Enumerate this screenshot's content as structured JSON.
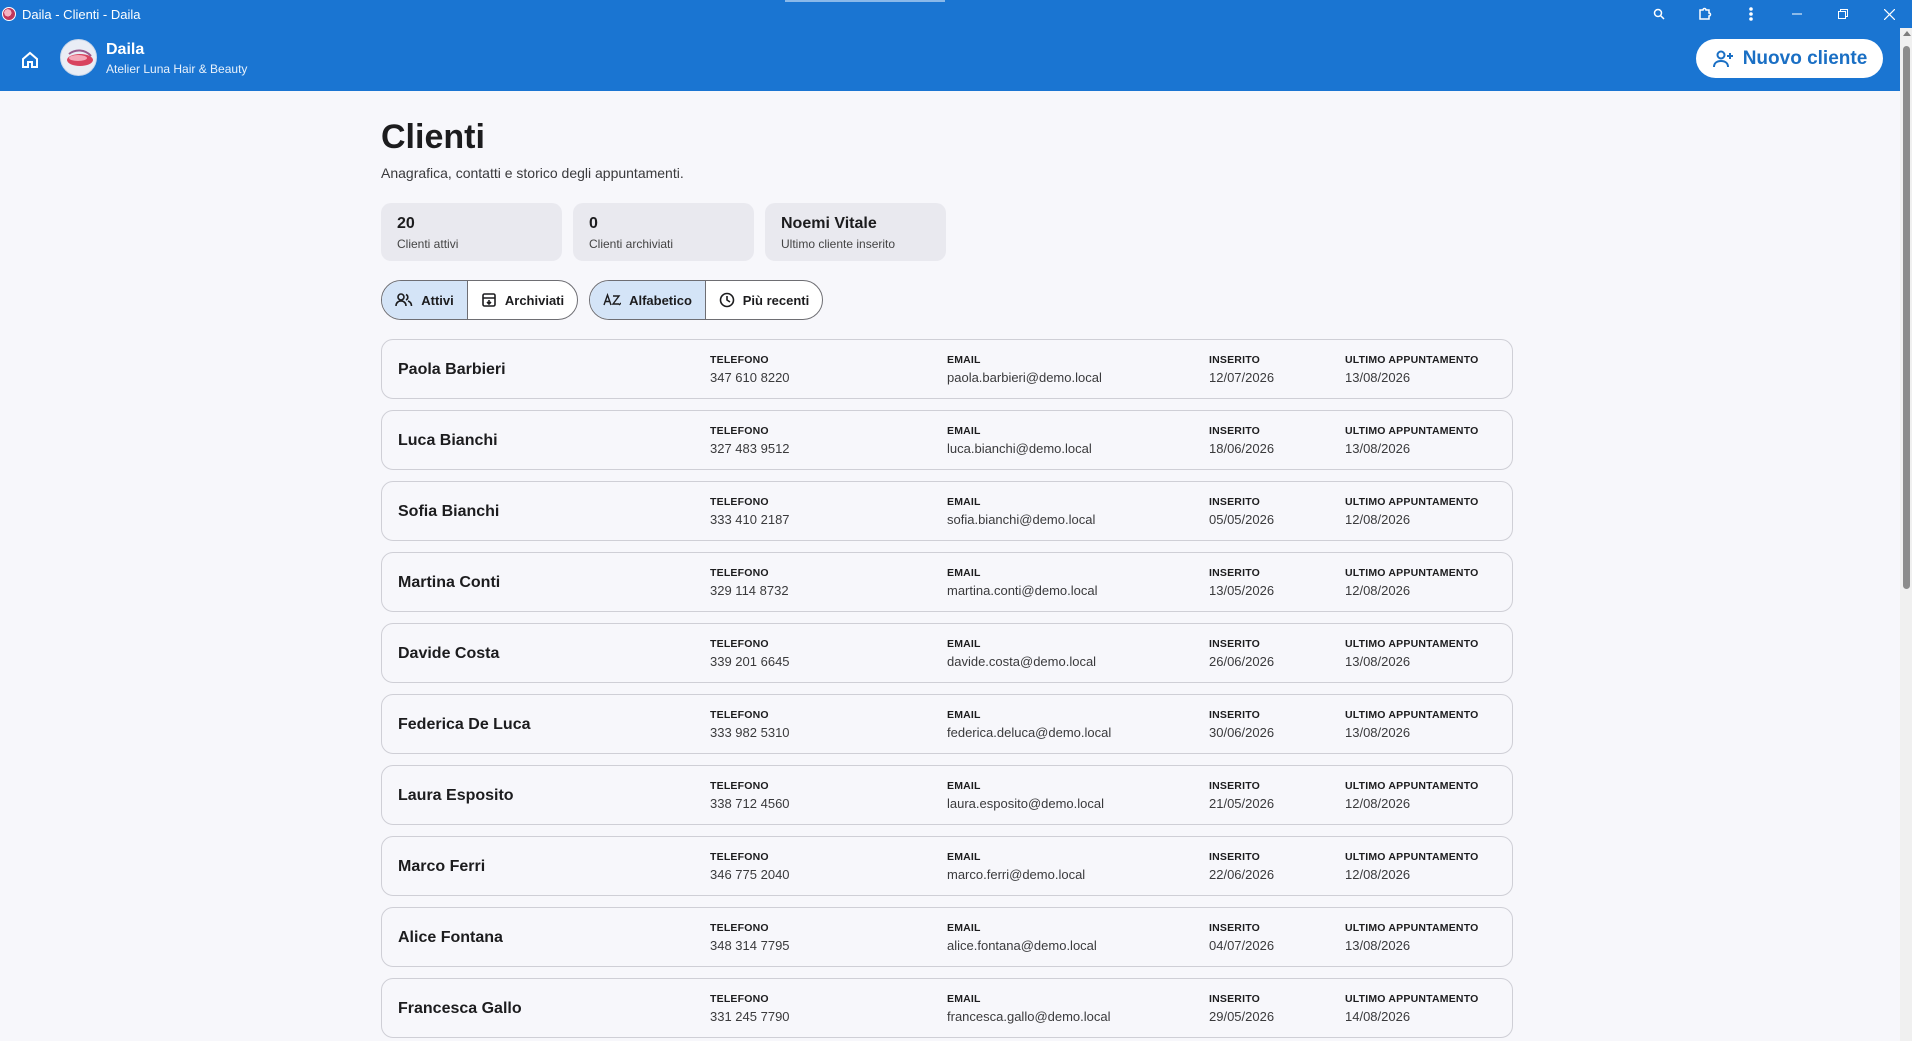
{
  "window": {
    "title": "Daila - Clienti - Daila"
  },
  "header": {
    "brand_name": "Daila",
    "brand_subtitle": "Atelier Luna Hair & Beauty",
    "new_client_label": "Nuovo cliente"
  },
  "page": {
    "title": "Clienti",
    "subtitle": "Anagrafica, contatti e storico degli appuntamenti."
  },
  "stats": [
    {
      "value": "20",
      "label": "Clienti attivi"
    },
    {
      "value": "0",
      "label": "Clienti archiviati"
    },
    {
      "value": "Noemi Vitale",
      "label": "Ultimo cliente inserito"
    }
  ],
  "filters": {
    "status": {
      "active": "Attivi",
      "archived": "Archiviati",
      "selected": "Attivi"
    },
    "sort": {
      "alpha": "Alfabetico",
      "recent": "Più recenti",
      "selected": "Alfabetico"
    }
  },
  "columns": {
    "phone": "TELEFONO",
    "email": "EMAIL",
    "inserted": "INSERITO",
    "last_appointment": "ULTIMO APPUNTAMENTO"
  },
  "clients": [
    {
      "name": "Paola Barbieri",
      "phone": "347 610 8220",
      "email": "paola.barbieri@demo.local",
      "inserted": "12/07/2026",
      "last": "13/08/2026"
    },
    {
      "name": "Luca Bianchi",
      "phone": "327 483 9512",
      "email": "luca.bianchi@demo.local",
      "inserted": "18/06/2026",
      "last": "13/08/2026"
    },
    {
      "name": "Sofia Bianchi",
      "phone": "333 410 2187",
      "email": "sofia.bianchi@demo.local",
      "inserted": "05/05/2026",
      "last": "12/08/2026"
    },
    {
      "name": "Martina Conti",
      "phone": "329 114 8732",
      "email": "martina.conti@demo.local",
      "inserted": "13/05/2026",
      "last": "12/08/2026"
    },
    {
      "name": "Davide Costa",
      "phone": "339 201 6645",
      "email": "davide.costa@demo.local",
      "inserted": "26/06/2026",
      "last": "13/08/2026"
    },
    {
      "name": "Federica De Luca",
      "phone": "333 982 5310",
      "email": "federica.deluca@demo.local",
      "inserted": "30/06/2026",
      "last": "13/08/2026"
    },
    {
      "name": "Laura Esposito",
      "phone": "338 712 4560",
      "email": "laura.esposito@demo.local",
      "inserted": "21/05/2026",
      "last": "12/08/2026"
    },
    {
      "name": "Marco Ferri",
      "phone": "346 775 2040",
      "email": "marco.ferri@demo.local",
      "inserted": "22/06/2026",
      "last": "12/08/2026"
    },
    {
      "name": "Alice Fontana",
      "phone": "348 314 7795",
      "email": "alice.fontana@demo.local",
      "inserted": "04/07/2026",
      "last": "13/08/2026"
    },
    {
      "name": "Francesca Gallo",
      "phone": "331 245 7790",
      "email": "francesca.gallo@demo.local",
      "inserted": "29/05/2026",
      "last": "14/08/2026"
    }
  ],
  "colors": {
    "brand_blue": "#1a75d2",
    "selected_segment": "#d4e4f7",
    "background": "#f7f7fb"
  }
}
